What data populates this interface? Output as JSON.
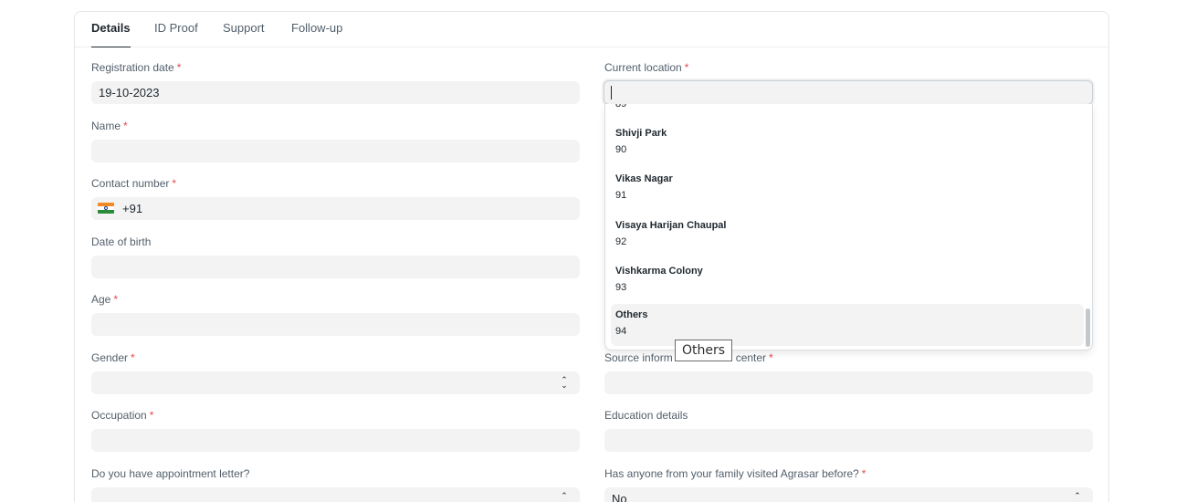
{
  "tabs": [
    "Details",
    "ID Proof",
    "Support",
    "Follow-up"
  ],
  "left_fields": {
    "registration_date": {
      "label": "Registration date",
      "value": "19-10-2023"
    },
    "name": {
      "label": "Name",
      "value": ""
    },
    "contact_number": {
      "label": "Contact number",
      "country_code": "+91"
    },
    "date_of_birth": {
      "label": "Date of birth",
      "value": ""
    },
    "age": {
      "label": "Age",
      "value": ""
    },
    "gender": {
      "label": "Gender",
      "value": ""
    },
    "occupation": {
      "label": "Occupation",
      "value": ""
    },
    "appointment_letter": {
      "label": "Do you have appointment letter?",
      "value": ""
    }
  },
  "right_fields": {
    "current_location": {
      "label": "Current location",
      "value": ""
    },
    "source_information": {
      "label_visible": "Source inform",
      "label_tail": "center"
    },
    "education_details": {
      "label": "Education details",
      "value": ""
    },
    "family_visited": {
      "label": "Has anyone from your family visited Agrasar before?",
      "value": "No"
    }
  },
  "required_mark": "*",
  "location_dropdown": {
    "partial_top": "89",
    "items": [
      {
        "name": "Shivji Park",
        "code": "90"
      },
      {
        "name": "Vikas Nagar",
        "code": "91"
      },
      {
        "name": "Visaya Harijan Chaupal",
        "code": "92"
      },
      {
        "name": "Vishkarma Colony",
        "code": "93"
      },
      {
        "name": "Others",
        "code": "94"
      }
    ]
  },
  "tooltip": "Others",
  "colors": {
    "required": "#e24c4c",
    "input_bg": "#f3f3f3",
    "text": "#1f272e",
    "label": "#525f6b"
  },
  "icons": {
    "select": "up-down-chevron-icon",
    "flag": "india-flag-icon"
  }
}
